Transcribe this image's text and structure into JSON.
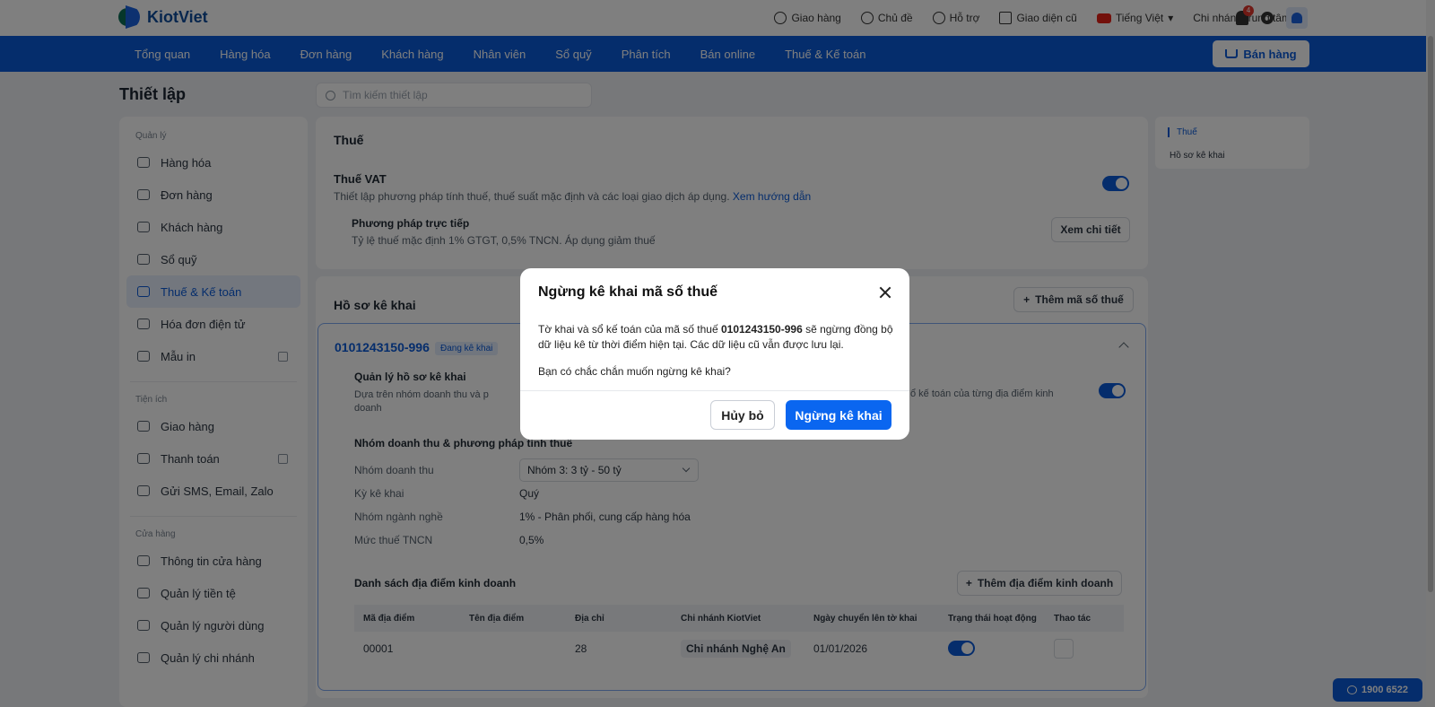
{
  "topbar": {
    "logo": "KiotViet",
    "links": [
      "Giao hàng",
      "Chủ đề",
      "Hỗ trợ",
      "Giao diện cũ"
    ],
    "language": "Tiếng Việt",
    "branch": "Chi nhánh trung tâm",
    "notification_count": "4"
  },
  "nav": {
    "items": [
      "Tổng quan",
      "Hàng hóa",
      "Đơn hàng",
      "Khách hàng",
      "Nhân viên",
      "Sổ quỹ",
      "Phân tích",
      "Bán online",
      "Thuế & Kế toán"
    ],
    "sell_label": "Bán hàng"
  },
  "page": {
    "title": "Thiết lập",
    "search_placeholder": "Tìm kiếm thiết lập"
  },
  "sidebar": {
    "groups": [
      {
        "label": "Quản lý",
        "items": [
          "Hàng hóa",
          "Đơn hàng",
          "Khách hàng",
          "Sổ quỹ",
          "Thuế & Kế toán",
          "Hóa đơn điện tử",
          "Mẫu in"
        ]
      },
      {
        "label": "Tiện ích",
        "items": [
          "Giao hàng",
          "Thanh toán",
          "Gửi SMS, Email, Zalo"
        ]
      },
      {
        "label": "Cửa hàng",
        "items": [
          "Thông tin cửa hàng",
          "Quản lý tiền tệ",
          "Quản lý người dùng",
          "Quản lý chi nhánh"
        ]
      }
    ]
  },
  "tax": {
    "title": "Thuế",
    "vat_title": "Thuế VAT",
    "vat_desc": "Thiết lập phương pháp tính thuế, thuế suất mặc định và các loại giao dịch áp dụng.",
    "vat_link": "Xem hướng dẫn",
    "method_title": "Phương pháp trực tiếp",
    "method_desc": "Tỷ lệ thuế mặc định 1% GTGT, 0,5% TNCN. Áp dụng giảm thuế",
    "detail_btn": "Xem chi tiết"
  },
  "profile": {
    "title": "Hồ sơ kê khai",
    "add_btn": "Thêm mã số thuế",
    "tax_code": "0101243150-996",
    "status": "Đang kê khai",
    "manage_title": "Quản lý hồ sơ kê khai",
    "manage_desc": "Dựa trên nhóm doanh thu và phương pháp tính thuế để quản lý hồ sơ khai thuế và sổ kế toán của từng địa điểm kinh doanh",
    "manage_desc_left": "Dựa trên nhóm doanh thu và p",
    "manage_desc_left2": "doanh",
    "manage_desc_right": "ổ kế toán của từng địa điểm kinh",
    "group_title": "Nhóm doanh thu & phương pháp tính thuế",
    "revenue_label": "Nhóm doanh thu",
    "revenue_value": "Nhóm 3: 3 tỷ - 50 tỷ",
    "period_label": "Kỳ kê khai",
    "period_value": "Quý",
    "industry_label": "Nhóm ngành nghề",
    "industry_value": "1% - Phân phối, cung cấp hàng hóa",
    "pit_label": "Mức thuế TNCN",
    "pit_value": "0,5%",
    "locations_title": "Danh sách địa điểm kinh doanh",
    "add_location_btn": "Thêm địa điểm kinh doanh",
    "table": {
      "headers": [
        "Mã địa điểm",
        "Tên địa điểm",
        "Địa chỉ",
        "Chi nhánh KiotViet",
        "Ngày chuyển lên tờ khai",
        "Trạng thái hoạt động",
        "Thao tác"
      ],
      "rows": [
        [
          "00001",
          "",
          "28",
          "Chi nhánh Nghệ An",
          "01/01/2026",
          "",
          ""
        ]
      ]
    }
  },
  "toc": {
    "items": [
      "Thuế",
      "Hồ sơ kê khai"
    ]
  },
  "hotline": "1900 6522",
  "modal": {
    "title": "Ngừng kê khai mã số thuế",
    "body_pre": "Tờ khai và sổ kế toán của mã số thuế ",
    "body_code": "0101243150-996",
    "body_post": " sẽ ngừng đồng bộ dữ liệu kê từ thời điểm hiện tại. Các dữ liệu cũ vẫn được lưu lại.",
    "question": "Bạn có chắc chắn muốn ngừng kê khai?",
    "cancel_label": "Hủy bỏ",
    "confirm_label": "Ngừng kê khai"
  }
}
